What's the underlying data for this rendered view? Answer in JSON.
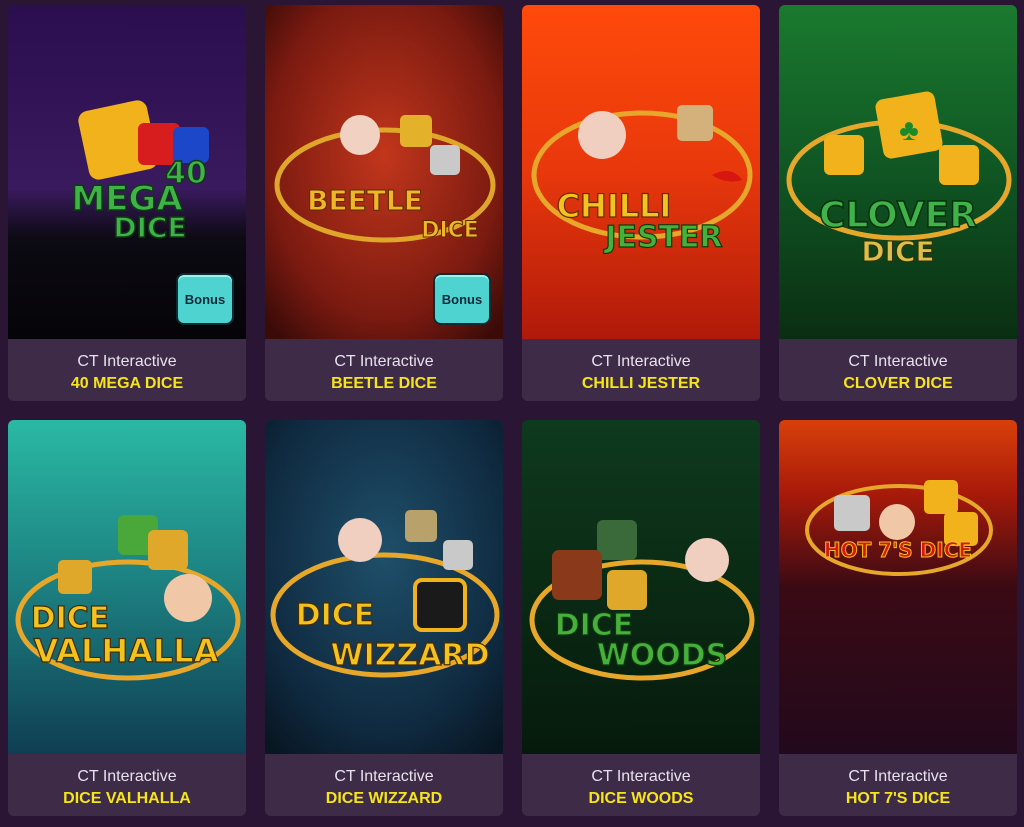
{
  "games": [
    {
      "provider": "CT Interactive",
      "title": "40 MEGA DICE",
      "logo": [
        "40",
        "MEGA",
        "DICE"
      ],
      "bonus": "Bonus"
    },
    {
      "provider": "CT Interactive",
      "title": "BEETLE DICE",
      "logo": [
        "BEETLE",
        "DICE"
      ],
      "bonus": "Bonus"
    },
    {
      "provider": "CT Interactive",
      "title": "CHILLI JESTER",
      "logo": [
        "CHILLI",
        "JESTER"
      ]
    },
    {
      "provider": "CT Interactive",
      "title": "CLOVER DICE",
      "logo": [
        "CLOVER",
        "DICE"
      ]
    },
    {
      "provider": "CT Interactive",
      "title": "DICE VALHALLA",
      "logo": [
        "DICE",
        "VALHALLA"
      ]
    },
    {
      "provider": "CT Interactive",
      "title": "DICE WIZZARD",
      "logo": [
        "DICE",
        "WIZZARD"
      ]
    },
    {
      "provider": "CT Interactive",
      "title": "DICE WOODS",
      "logo": [
        "DICE",
        "WOODS"
      ]
    },
    {
      "provider": "CT Interactive",
      "title": "HOT 7'S DICE",
      "logo": [
        "HOT 7'S DICE"
      ]
    }
  ],
  "colors": {
    "page_bg": "#2a1534",
    "card_info_bg": "#3e2b47",
    "title": "#f5e51a",
    "provider": "#e8e2ec",
    "bonus_bg": "#4fd3d0"
  }
}
